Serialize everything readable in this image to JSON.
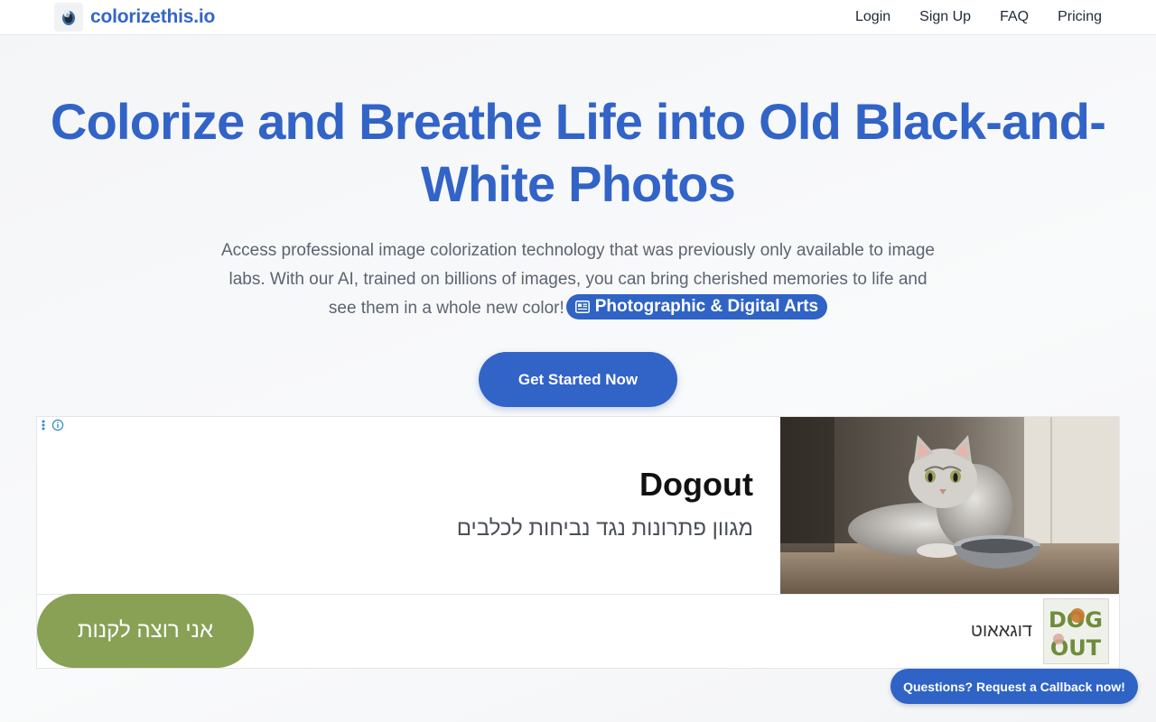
{
  "header": {
    "brand_name": "colorizethis.io",
    "nav": [
      "Login",
      "Sign Up",
      "FAQ",
      "Pricing"
    ]
  },
  "hero": {
    "title": "Colorize and Breathe Life into Old Black-and-White Photos",
    "description": "Access professional image colorization technology that was previously only available to image labs. With our AI, trained on billions of images, you can bring cherished memories to life and see them in a whole new color!",
    "tag_label": "Photographic & Digital Arts",
    "tag_icon": "newspaper-icon",
    "cta_label": "Get Started Now"
  },
  "ad": {
    "headline": "Dogout",
    "subtitle": "מגוון פתרונות נגד נביחות לכלבים",
    "buy_label": "אני רוצה לקנות",
    "advertiser": "דוגאאוט",
    "logo_text_top": "DOG",
    "logo_text_bottom": "OUT",
    "image": "cat-with-bowl"
  },
  "callback_label": "Questions? Request a Callback now!",
  "colors": {
    "brand_blue": "#3263c7",
    "ad_button_green": "#89a155"
  }
}
